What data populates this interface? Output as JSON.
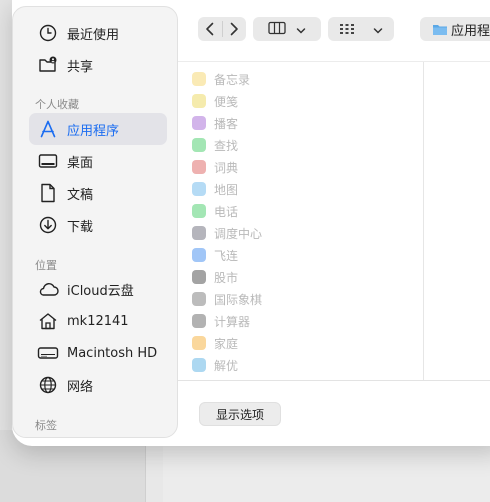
{
  "sidebar": {
    "top_items": [
      {
        "label": "最近使用",
        "icon": "clock-icon"
      },
      {
        "label": "共享",
        "icon": "shared-folder-icon"
      }
    ],
    "favorites_header": "个人收藏",
    "favorites": [
      {
        "label": "应用程序",
        "icon": "applications-icon",
        "selected": true
      },
      {
        "label": "桌面",
        "icon": "desktop-icon"
      },
      {
        "label": "文稿",
        "icon": "document-icon"
      },
      {
        "label": "下载",
        "icon": "download-icon"
      }
    ],
    "locations_header": "位置",
    "locations": [
      {
        "label": "iCloud云盘",
        "icon": "cloud-icon"
      },
      {
        "label": "mk12141",
        "icon": "home-icon"
      },
      {
        "label": "Macintosh HD",
        "icon": "disk-icon"
      },
      {
        "label": "网络",
        "icon": "globe-icon"
      }
    ],
    "tags_header": "标签"
  },
  "toolbar": {
    "back_icon": "chevron-left-icon",
    "forward_icon": "chevron-right-icon",
    "view_icon": "column-view-icon",
    "group_icon": "grid-icon",
    "location_label": "应用程"
  },
  "apps": [
    {
      "label": "备忘录",
      "color": "#f5d15a"
    },
    {
      "label": "便笺",
      "color": "#e8d24a"
    },
    {
      "label": "播客",
      "color": "#9b59d0"
    },
    {
      "label": "查找",
      "color": "#34c759"
    },
    {
      "label": "词典",
      "color": "#d9534f"
    },
    {
      "label": "地图",
      "color": "#5ab0e8"
    },
    {
      "label": "电话",
      "color": "#34c759"
    },
    {
      "label": "调度中心",
      "color": "#5b5b6b"
    },
    {
      "label": "飞连",
      "color": "#2f80ed"
    },
    {
      "label": "股市",
      "color": "#333333"
    },
    {
      "label": "国际象棋",
      "color": "#6b6b6b"
    },
    {
      "label": "计算器",
      "color": "#555555"
    },
    {
      "label": "家庭",
      "color": "#f5a623"
    },
    {
      "label": "解优",
      "color": "#4aa8e0"
    }
  ],
  "footer": {
    "options_button": "显示选项"
  }
}
